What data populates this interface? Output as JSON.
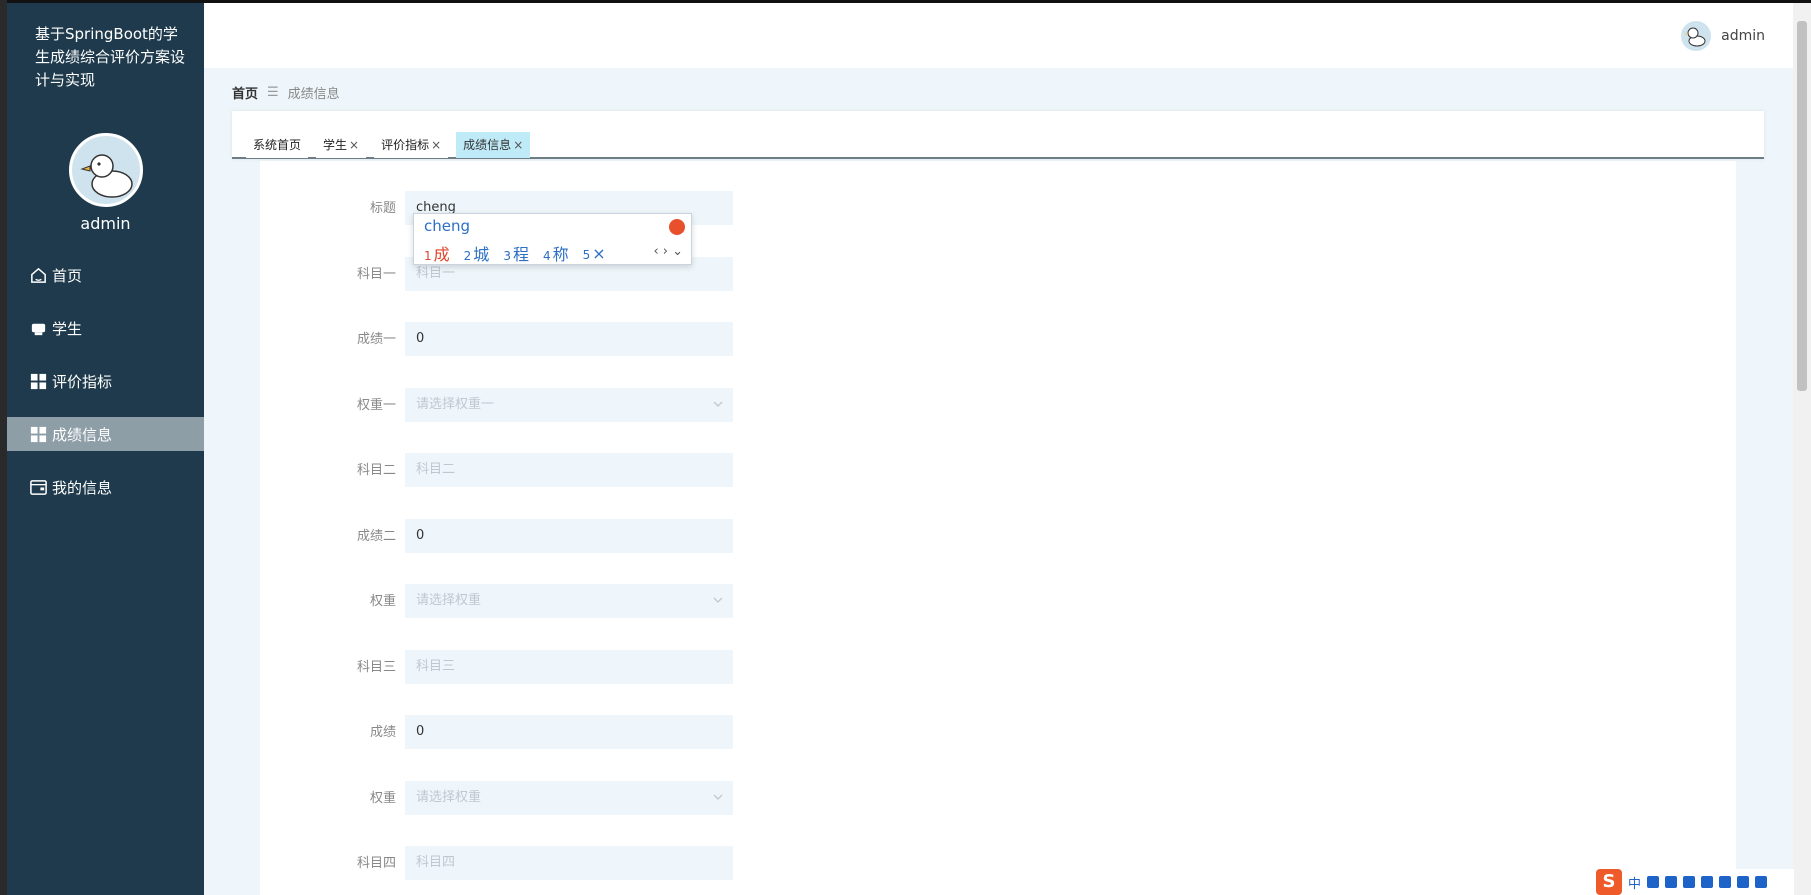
{
  "sidebar": {
    "system_title": "基于SpringBoot的学生成绩综合评价方案设计与实现",
    "user_name": "admin",
    "items": [
      {
        "label": "首页",
        "icon": "home-icon"
      },
      {
        "label": "学生",
        "icon": "student-icon"
      },
      {
        "label": "评价指标",
        "icon": "grid-icon"
      },
      {
        "label": "成绩信息",
        "icon": "grid-icon",
        "active": true
      },
      {
        "label": "我的信息",
        "icon": "wallet-icon"
      }
    ]
  },
  "header": {
    "user_name": "admin"
  },
  "breadcrumb": {
    "home": "首页",
    "separator": "☰",
    "current": "成绩信息"
  },
  "tabs": [
    {
      "label": "系统首页",
      "closable": false
    },
    {
      "label": "学生",
      "closable": true
    },
    {
      "label": "评价指标",
      "closable": true
    },
    {
      "label": "成绩信息",
      "closable": true,
      "active": true
    }
  ],
  "tab_close_glyph": "×",
  "form": {
    "fields": [
      {
        "label": "标题",
        "value": "cheng",
        "placeholder": ""
      },
      {
        "label": "科目一",
        "value": "",
        "placeholder": "科目一"
      },
      {
        "label": "成绩一",
        "value": "0",
        "placeholder": ""
      },
      {
        "label": "权重一",
        "value": "",
        "placeholder": "请选择权重一",
        "select": true
      },
      {
        "label": "科目二",
        "value": "",
        "placeholder": "科目二"
      },
      {
        "label": "成绩二",
        "value": "0",
        "placeholder": ""
      },
      {
        "label": "权重",
        "value": "",
        "placeholder": "请选择权重",
        "select": true
      },
      {
        "label": "科目三",
        "value": "",
        "placeholder": "科目三"
      },
      {
        "label": "成绩",
        "value": "0",
        "placeholder": ""
      },
      {
        "label": "权重",
        "value": "",
        "placeholder": "请选择权重",
        "select": true
      },
      {
        "label": "科目四",
        "value": "",
        "placeholder": "科目四"
      }
    ]
  },
  "ime": {
    "input": "cheng",
    "candidates": [
      {
        "num": "1",
        "char": "成"
      },
      {
        "num": "2",
        "char": "城"
      },
      {
        "num": "3",
        "char": "程"
      },
      {
        "num": "4",
        "char": "称"
      },
      {
        "num": "5",
        "char": "×"
      }
    ],
    "nav": "‹ › ⌄"
  },
  "tray": {
    "logo": "S",
    "lang": "中"
  },
  "colors": {
    "sidebar_bg": "#1e3a4c",
    "active_menu": "#8e9ea7",
    "active_tab": "#bfeaf7",
    "input_bg": "#eef6fb"
  }
}
